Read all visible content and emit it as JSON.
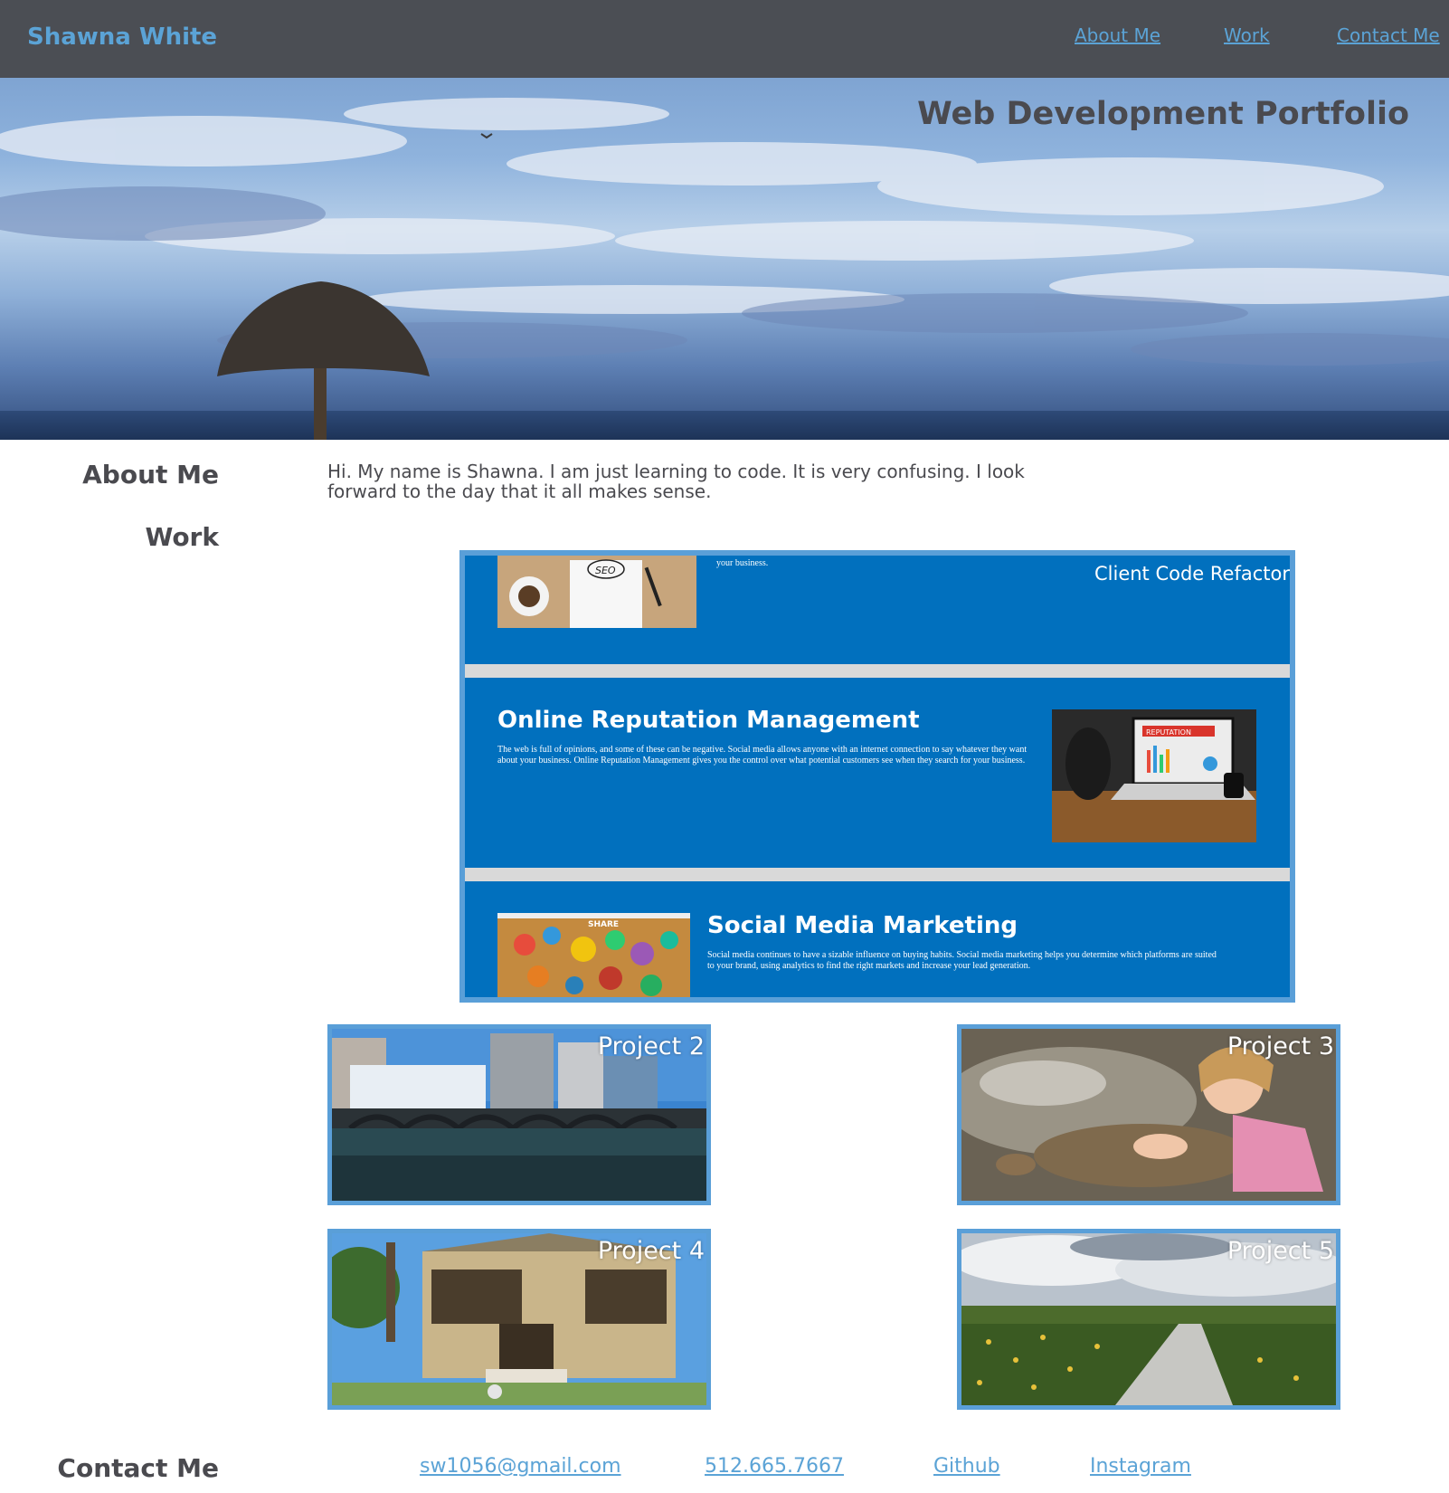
{
  "header": {
    "brand": "Shawna White",
    "nav": [
      "About Me",
      "Work",
      "Contact Me"
    ]
  },
  "hero": {
    "title": "Web Development Portfolio"
  },
  "about": {
    "heading": "About Me",
    "text": "Hi. My name is Shawna. I am just learning to code. It is very confusing. I look forward to the day that it all makes sense."
  },
  "work": {
    "heading": "Work",
    "featured": {
      "label": "Client Code Refactor",
      "top_snippet": "your business.",
      "sections": [
        {
          "title": "Online Reputation Management",
          "text": "The web is full of opinions, and some of these can be negative. Social media allows anyone with an internet connection to say whatever they want about your business. Online Reputation Management gives you the control over what potential customers see when they search for your business.",
          "image_text": "REPUTATION"
        },
        {
          "title": "Social Media Marketing",
          "text": "Social media continues to have a sizable influence on buying habits. Social media marketing helps you determine which platforms are suited to your brand, using analytics to find the right markets and increase your lead generation.",
          "image_text": "SHARE"
        }
      ],
      "seo_image_text": "SEO"
    },
    "projects": [
      "Project 2",
      "Project 3",
      "Project 4",
      "Project 5"
    ]
  },
  "contact": {
    "heading": "Contact Me",
    "links": [
      "sw1056@gmail.com",
      "512.665.7667",
      "Github",
      "Instagram"
    ]
  },
  "colors": {
    "topbar": "#4b4e54",
    "accent": "#5ba3d6",
    "panel_blue": "#0170be",
    "frame_blue": "#5a9fd8",
    "text": "#4a4a4f"
  }
}
